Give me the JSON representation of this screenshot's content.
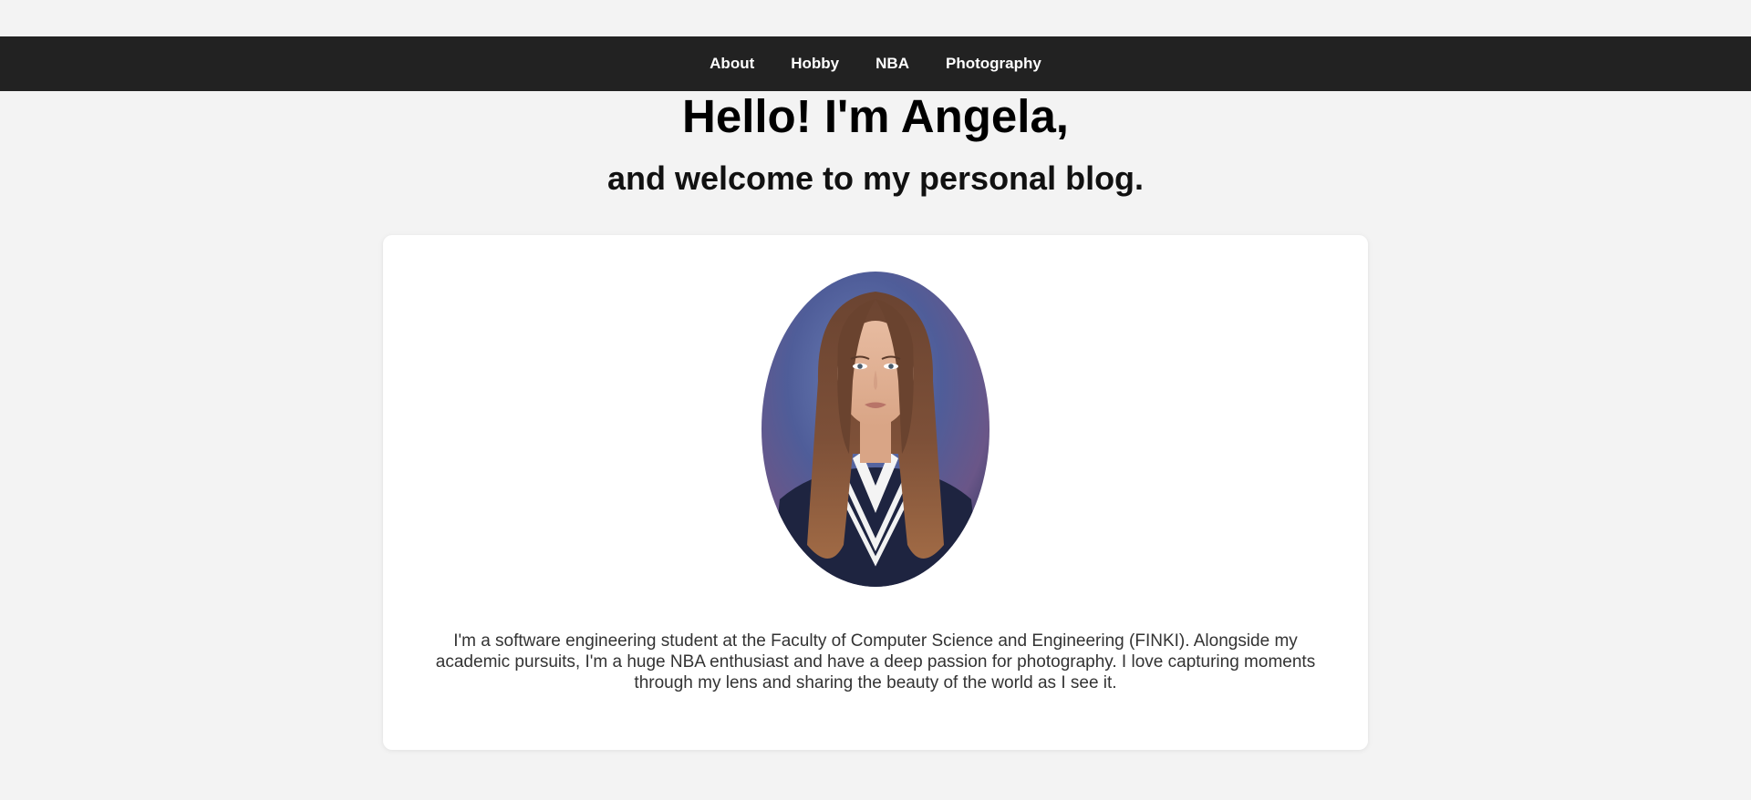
{
  "nav": {
    "items": [
      {
        "label": "About"
      },
      {
        "label": "Hobby"
      },
      {
        "label": "NBA"
      },
      {
        "label": "Photography"
      }
    ]
  },
  "hero": {
    "title": "Hello! I'm Angela,",
    "subtitle": "and welcome to my personal blog."
  },
  "profile": {
    "bio": "I'm a software engineering student at the Faculty of Computer Science and Engineering (FINKI). Alongside my academic pursuits, I'm a huge NBA enthusiast and have a deep passion for photography. I love capturing moments through my lens and sharing the beauty of the world as I see it."
  },
  "colors": {
    "page_background": "#f3f3f3",
    "nav_background": "#222222",
    "nav_text": "#ffffff",
    "card_background": "#ffffff",
    "body_text": "#333333"
  }
}
